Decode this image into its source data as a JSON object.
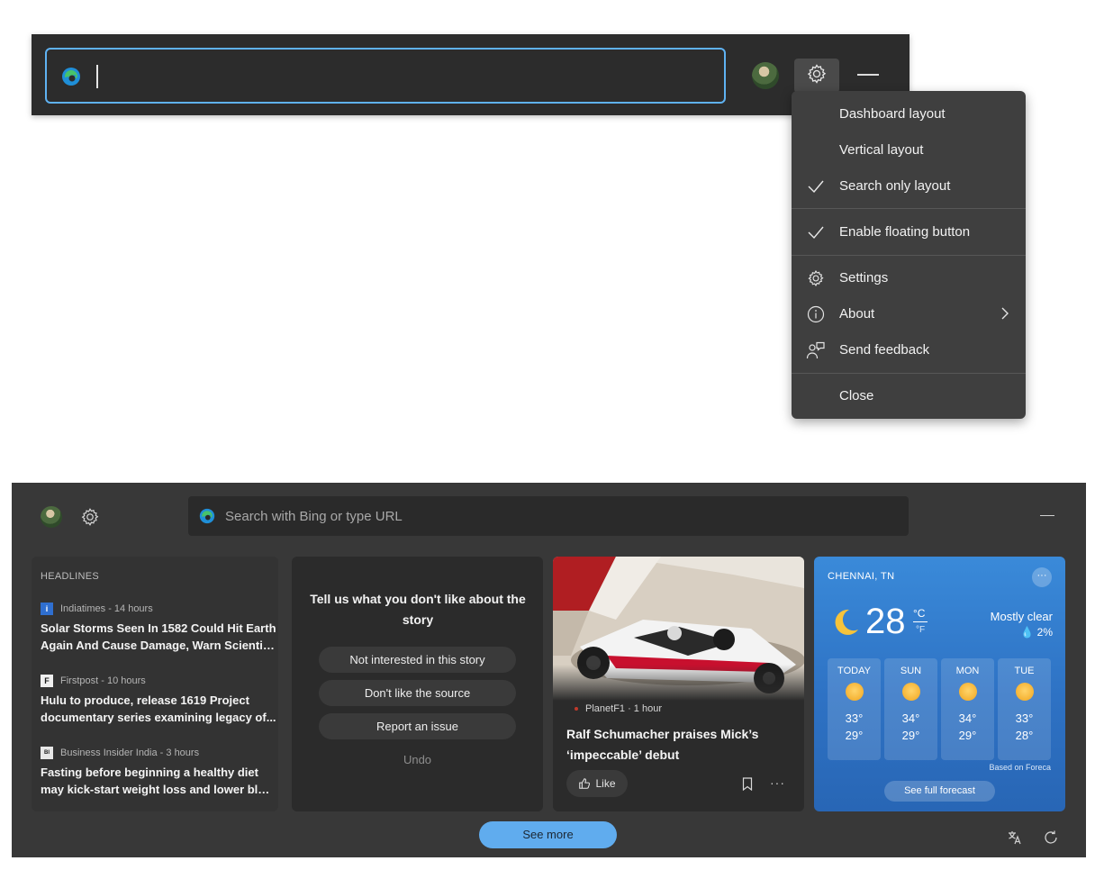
{
  "topbar": {
    "search_value": ""
  },
  "menu": {
    "items": [
      {
        "label": "Dashboard layout",
        "checked": false
      },
      {
        "label": "Vertical layout",
        "checked": false
      },
      {
        "label": "Search only layout",
        "checked": true
      },
      {
        "label": "Enable floating button",
        "checked": true
      },
      {
        "label": "Settings",
        "icon": "gear-icon"
      },
      {
        "label": "About",
        "icon": "info-icon",
        "submenu": true
      },
      {
        "label": "Send feedback",
        "icon": "feedback-icon"
      },
      {
        "label": "Close"
      }
    ]
  },
  "dashboard": {
    "search_placeholder": "Search with Bing or type URL",
    "headlines": {
      "header": "HEADLINES",
      "items": [
        {
          "source": "Indiatimes",
          "age": "14 hours",
          "meta": "Indiatimes - 14 hours",
          "title_line1": "Solar Storms Seen In 1582 Could Hit Earth",
          "title_line2": "Again And Cause Damage, Warn Scientists"
        },
        {
          "source": "Firstpost",
          "age": "10 hours",
          "meta": "Firstpost - 10 hours",
          "title_line1": "Hulu to produce, release 1619 Project",
          "title_line2": "documentary series examining legacy of..."
        },
        {
          "source": "Business Insider India",
          "age": "3 hours",
          "meta": "Business Insider India - 3 hours",
          "title_line1": "Fasting before beginning a healthy diet",
          "title_line2": "may kick-start weight loss and lower bloo..."
        }
      ]
    },
    "feedback": {
      "question": "Tell us what you don't like about the story",
      "options": [
        "Not interested in this story",
        "Don't like the source",
        "Report an issue"
      ],
      "undo": "Undo"
    },
    "story": {
      "meta": "PlanetF1 · 1 hour",
      "title": "Ralf Schumacher praises Mick’s ‘impeccable’ debut",
      "like_label": "Like"
    },
    "weather": {
      "location": "CHENNAI, TN",
      "temp": "28",
      "unit_c": "°C",
      "unit_f": "°F",
      "condition": "Mostly clear",
      "precip": "2%",
      "days": [
        {
          "name": "TODAY",
          "hi": "33°",
          "lo": "29°"
        },
        {
          "name": "SUN",
          "hi": "34°",
          "lo": "29°"
        },
        {
          "name": "MON",
          "hi": "34°",
          "lo": "29°"
        },
        {
          "name": "TUE",
          "hi": "33°",
          "lo": "28°"
        }
      ],
      "based_on": "Based on Foreca",
      "forecast_button": "See full forecast"
    },
    "see_more": "See more"
  },
  "colors": {
    "focus_border": "#5fb2f2",
    "see_more": "#60acee",
    "weather_blue": "#2e72c4"
  }
}
